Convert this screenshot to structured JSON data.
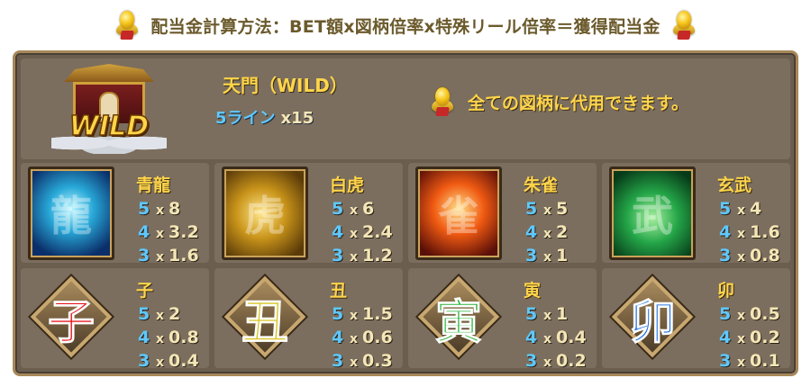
{
  "header": {
    "formula": "配当金計算方法：BET額x図柄倍率x特殊リール倍率＝獲得配当金"
  },
  "wild": {
    "emblem_text": "WILD",
    "name": "天門（WILD）",
    "payout_label": "5ライン",
    "payout_mult": "x15",
    "description": "全ての図柄に代用できます。"
  },
  "symbols": [
    {
      "name": "青龍",
      "icon": "azure-dragon-icon",
      "pays": [
        {
          "count": "5",
          "x": "x",
          "value": "8"
        },
        {
          "count": "4",
          "x": "x",
          "value": "3.2"
        },
        {
          "count": "3",
          "x": "x",
          "value": "1.6"
        }
      ]
    },
    {
      "name": "白虎",
      "icon": "white-tiger-icon",
      "pays": [
        {
          "count": "5",
          "x": "x",
          "value": "6"
        },
        {
          "count": "4",
          "x": "x",
          "value": "2.4"
        },
        {
          "count": "3",
          "x": "x",
          "value": "1.2"
        }
      ]
    },
    {
      "name": "朱雀",
      "icon": "vermilion-bird-icon",
      "pays": [
        {
          "count": "5",
          "x": "x",
          "value": "5"
        },
        {
          "count": "4",
          "x": "x",
          "value": "2"
        },
        {
          "count": "3",
          "x": "x",
          "value": "1"
        }
      ]
    },
    {
      "name": "玄武",
      "icon": "black-tortoise-icon",
      "pays": [
        {
          "count": "5",
          "x": "x",
          "value": "4"
        },
        {
          "count": "4",
          "x": "x",
          "value": "1.6"
        },
        {
          "count": "3",
          "x": "x",
          "value": "0.8"
        }
      ]
    },
    {
      "name": "子",
      "glyph": "子",
      "color": "#e8141a",
      "pays": [
        {
          "count": "5",
          "x": "x",
          "value": "2"
        },
        {
          "count": "4",
          "x": "x",
          "value": "0.8"
        },
        {
          "count": "3",
          "x": "x",
          "value": "0.4"
        }
      ]
    },
    {
      "name": "丑",
      "glyph": "丑",
      "color": "#d6c21a",
      "pays": [
        {
          "count": "5",
          "x": "x",
          "value": "1.5"
        },
        {
          "count": "4",
          "x": "x",
          "value": "0.6"
        },
        {
          "count": "3",
          "x": "x",
          "value": "0.3"
        }
      ]
    },
    {
      "name": "寅",
      "glyph": "寅",
      "color": "#1fae2e",
      "pays": [
        {
          "count": "5",
          "x": "x",
          "value": "1"
        },
        {
          "count": "4",
          "x": "x",
          "value": "0.4"
        },
        {
          "count": "3",
          "x": "x",
          "value": "0.2"
        }
      ]
    },
    {
      "name": "卯",
      "glyph": "卯",
      "color": "#1f6fe0",
      "pays": [
        {
          "count": "5",
          "x": "x",
          "value": "0.5"
        },
        {
          "count": "4",
          "x": "x",
          "value": "0.2"
        },
        {
          "count": "3",
          "x": "x",
          "value": "0.1"
        }
      ]
    }
  ]
}
